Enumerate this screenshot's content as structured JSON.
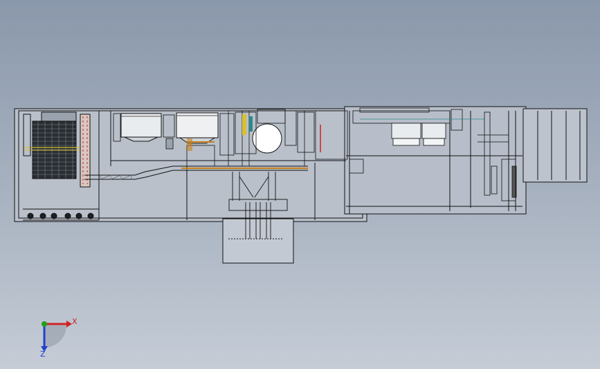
{
  "viewport": {
    "background_top": "#8a98ab",
    "background_bottom": "#c5ccd6",
    "line_color": "#111111"
  },
  "model": {
    "description_icon": "cad-assembly-drawing",
    "accent_colors": {
      "orange_pipe": "#c8801a",
      "red_marker": "#cc2020",
      "yellow_part": "#d8c030",
      "teal_part": "#2a8a8a"
    }
  },
  "triad": {
    "x_label": "X",
    "z_label": "Z",
    "x_color": "#d02020",
    "y_color": "#20a020",
    "z_color": "#2040d0"
  }
}
